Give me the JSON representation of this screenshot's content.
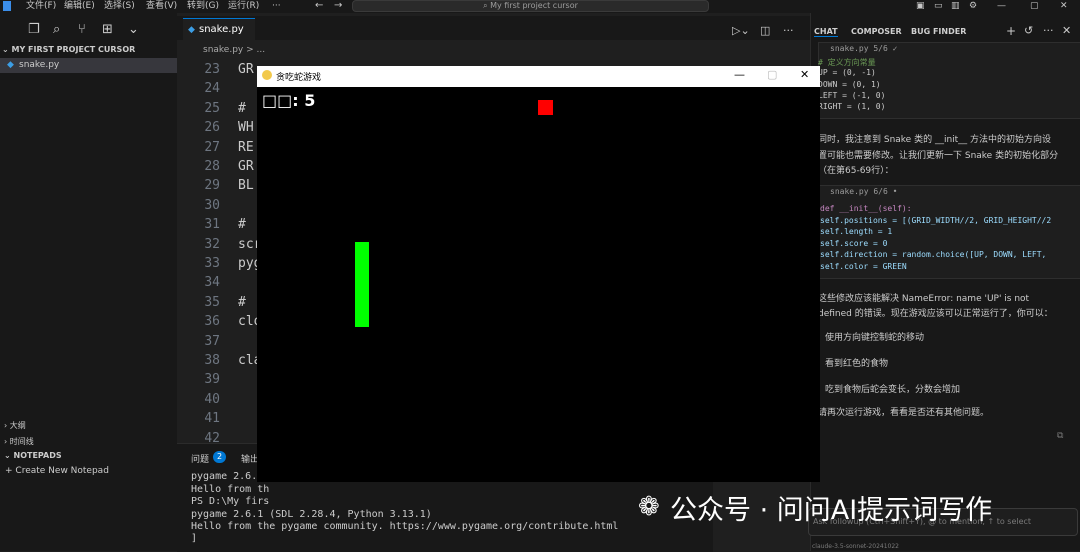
{
  "titlebar": {
    "menus": [
      "文件(F)",
      "编辑(E)",
      "选择(S)",
      "查看(V)",
      "转到(G)",
      "运行(R)",
      "···"
    ],
    "search_placeholder": "My first project cursor"
  },
  "sidebar": {
    "project_header": "MY FIRST PROJECT CURSOR",
    "file": "snake.py",
    "sections": [
      "大纲",
      "时间线",
      "NOTEPADS"
    ],
    "new_notepad": "Create New Notepad"
  },
  "editor": {
    "tab_label": "snake.py",
    "breadcrumb": "snake.py  > ...",
    "lines": [
      {
        "n": "23",
        "code": "GR"
      },
      {
        "n": "24",
        "code": ""
      },
      {
        "n": "25",
        "code": "#"
      },
      {
        "n": "26",
        "code": "WH"
      },
      {
        "n": "27",
        "code": "RE"
      },
      {
        "n": "28",
        "code": "GR"
      },
      {
        "n": "29",
        "code": "BL"
      },
      {
        "n": "30",
        "code": ""
      },
      {
        "n": "31",
        "code": "#"
      },
      {
        "n": "32",
        "code": "scr"
      },
      {
        "n": "33",
        "code": "pyg"
      },
      {
        "n": "34",
        "code": ""
      },
      {
        "n": "35",
        "code": "#"
      },
      {
        "n": "36",
        "code": "clo"
      },
      {
        "n": "37",
        "code": ""
      },
      {
        "n": "38",
        "code": "cla"
      },
      {
        "n": "39",
        "code": ""
      },
      {
        "n": "40",
        "code": ""
      },
      {
        "n": "41",
        "code": ""
      },
      {
        "n": "42",
        "code": ""
      }
    ]
  },
  "panel": {
    "tabs": [
      "问题",
      "输出"
    ],
    "problems_badge": "2",
    "terminal_lines": [
      "pygame 2.6.1",
      "Hello from th",
      "PS D:\\My firs",
      "pygame 2.6.1 (SDL 2.28.4, Python 3.13.1)",
      "Hello from the pygame community. https://www.pygame.org/contribute.html",
      "]"
    ]
  },
  "game": {
    "window_title": "贪吃蛇游戏",
    "score_label": "□□: 5",
    "snake_color": "#00ff00",
    "food_color": "#ff0000"
  },
  "chat": {
    "tabs": [
      "CHAT",
      "COMPOSER",
      "BUG FINDER"
    ],
    "code1_file": "snake.py  5/6 ✓",
    "code1_lines": [
      "# 定义方向常量",
      "UP = (0, -1)",
      "DOWN = (0, 1)",
      "LEFT = (-1, 0)",
      "RIGHT = (1, 0)"
    ],
    "para1": [
      "同时，我注意到 Snake 类的 __init__ 方法中的初始方向设",
      "置可能也需要修改。让我们更新一下 Snake 类的初始化部分",
      "（在第65-69行）："
    ],
    "code2_file": "snake.py  6/6 •",
    "code2_lines": [
      "def __init__(self):",
      "    self.positions = [(GRID_WIDTH//2, GRID_HEIGHT//2",
      "    self.length = 1",
      "    self.score = 0",
      "    self.direction = random.choice([UP, DOWN, LEFT,",
      "    self.color = GREEN"
    ],
    "para2": [
      "这些修改应该能解决 NameError: name 'UP' is not",
      "defined 的错误。现在游戏应该可以正常运行了，你可以："
    ],
    "list": [
      "使用方向键控制蛇的移动",
      "看到红色的食物",
      "吃到食物后蛇会变长，分数会增加"
    ],
    "para3": "请再次运行游戏，看看是否还有其他问题。",
    "input_placeholder": "Ask followup (Ctrl+Shift+Y), @ to mention, ↑ to select",
    "footer": "claude-3.5-sonnet-20241022"
  },
  "watermark": "公众号 · 问问AI提示词写作"
}
